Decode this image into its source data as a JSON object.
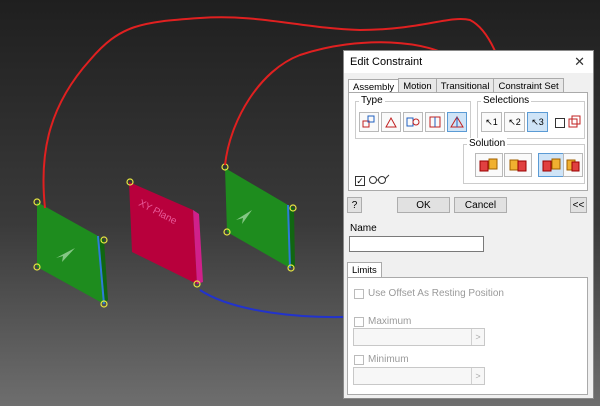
{
  "viewport": {
    "plane_text": "XY Plane",
    "colors": {
      "red_line": "#e02020",
      "blue_line": "#2233cc",
      "green_face": "#1e8c1e",
      "pink_face": "#b8003c"
    }
  },
  "dialog": {
    "title": "Edit Constraint",
    "close_glyph": "✕",
    "tabs": [
      {
        "label": "Assembly",
        "active": true
      },
      {
        "label": "Motion"
      },
      {
        "label": "Transitional"
      },
      {
        "label": "Constraint Set"
      }
    ],
    "type_label": "Type",
    "selections_label": "Selections",
    "selection_buttons": [
      "1",
      "2",
      "3"
    ],
    "solution_label": "Solution",
    "ok_label": "OK",
    "cancel_label": "Cancel",
    "expand_label": "<<",
    "help_glyph": "?",
    "name_label": "Name",
    "name_value": "",
    "limits_tab": "Limits",
    "use_offset_label": "Use Offset As Resting Position",
    "maximum_label": "Maximum",
    "minimum_label": "Minimum",
    "spin_arrow": ">"
  }
}
